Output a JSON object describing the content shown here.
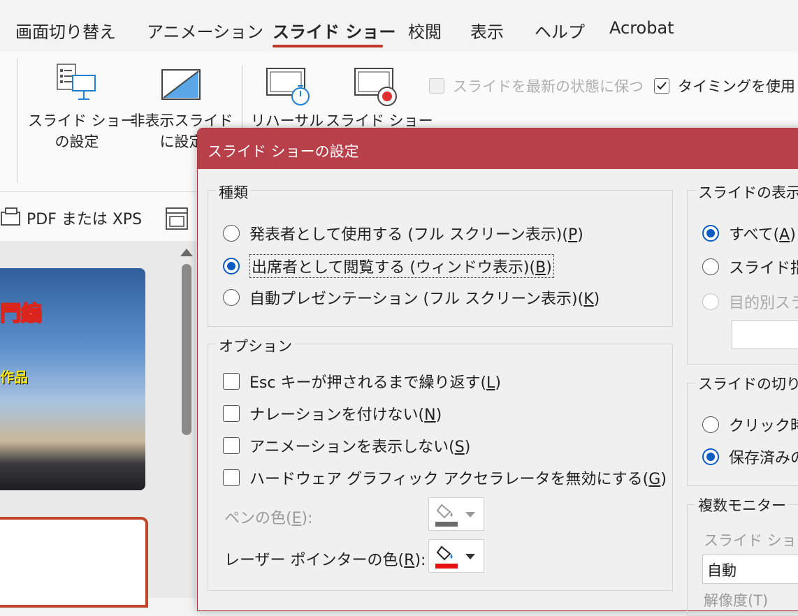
{
  "ribbon_tabs": {
    "transitions": "画面切り替え",
    "animations": "アニメーション",
    "slideshow": "スライド ショー",
    "review": "校閲",
    "view": "表示",
    "help": "ヘルプ",
    "acrobat": "Acrobat"
  },
  "ribbon": {
    "setup_line1": "スライド ショー",
    "setup_line2": "の設定",
    "hide_line1": "非表示スライド",
    "hide_line2": "に設定",
    "rehearse": "リハーサル",
    "record": "スライド ショー",
    "keep_updated": "スライドを最新の状態に保つ",
    "use_timings": "タイミングを使用",
    "use_timings_checked": true
  },
  "left_panel": {
    "export_label": "PDF または XPS",
    "thumb1_title": "門編",
    "thumb1_sub": "作品"
  },
  "dialog": {
    "title": "スライド ショーの設定",
    "type_group": {
      "label": "種類",
      "opt1": "発表者として使用する (フル スクリーン表示)(",
      "opt1_key": "P",
      "opt2": "出席者として閲覧する (ウィンドウ表示)(",
      "opt2_key": "B",
      "opt3": "自動プレゼンテーション (フル スクリーン表示)(",
      "opt3_key": "K",
      "close": ")"
    },
    "options_group": {
      "label": "オプション",
      "loop": "Esc キーが押されるまで繰り返す(",
      "loop_key": "L",
      "no_narration": "ナレーションを付けない(",
      "no_narration_key": "N",
      "no_animation": "アニメーションを表示しない(",
      "no_animation_key": "S",
      "disable_hw": "ハードウェア グラフィック アクセラレータを無効にする(",
      "disable_hw_key": "G",
      "close": ")",
      "pen_color": "ペンの色(",
      "pen_color_key": "E",
      "pen_close": "):",
      "laser_color": "レーザー ポインターの色(",
      "laser_color_key": "R",
      "laser_close": "):",
      "pen_swatch": "#6b6b6b",
      "laser_swatch": "#e81010"
    },
    "show_slides_group": {
      "label": "スライドの表示",
      "all": "すべて(",
      "all_key": "A",
      "all_close": ")",
      "from": "スライド指定",
      "custom": "目的別スラ"
    },
    "advance_group": {
      "label": "スライドの切り替",
      "manual": "クリック時(",
      "timings": "保存済みの"
    },
    "monitors_group": {
      "label": "複数モニター",
      "monitor_label": "スライド ショーの",
      "monitor_value": "自動",
      "resolution": "解像度(T)"
    }
  }
}
